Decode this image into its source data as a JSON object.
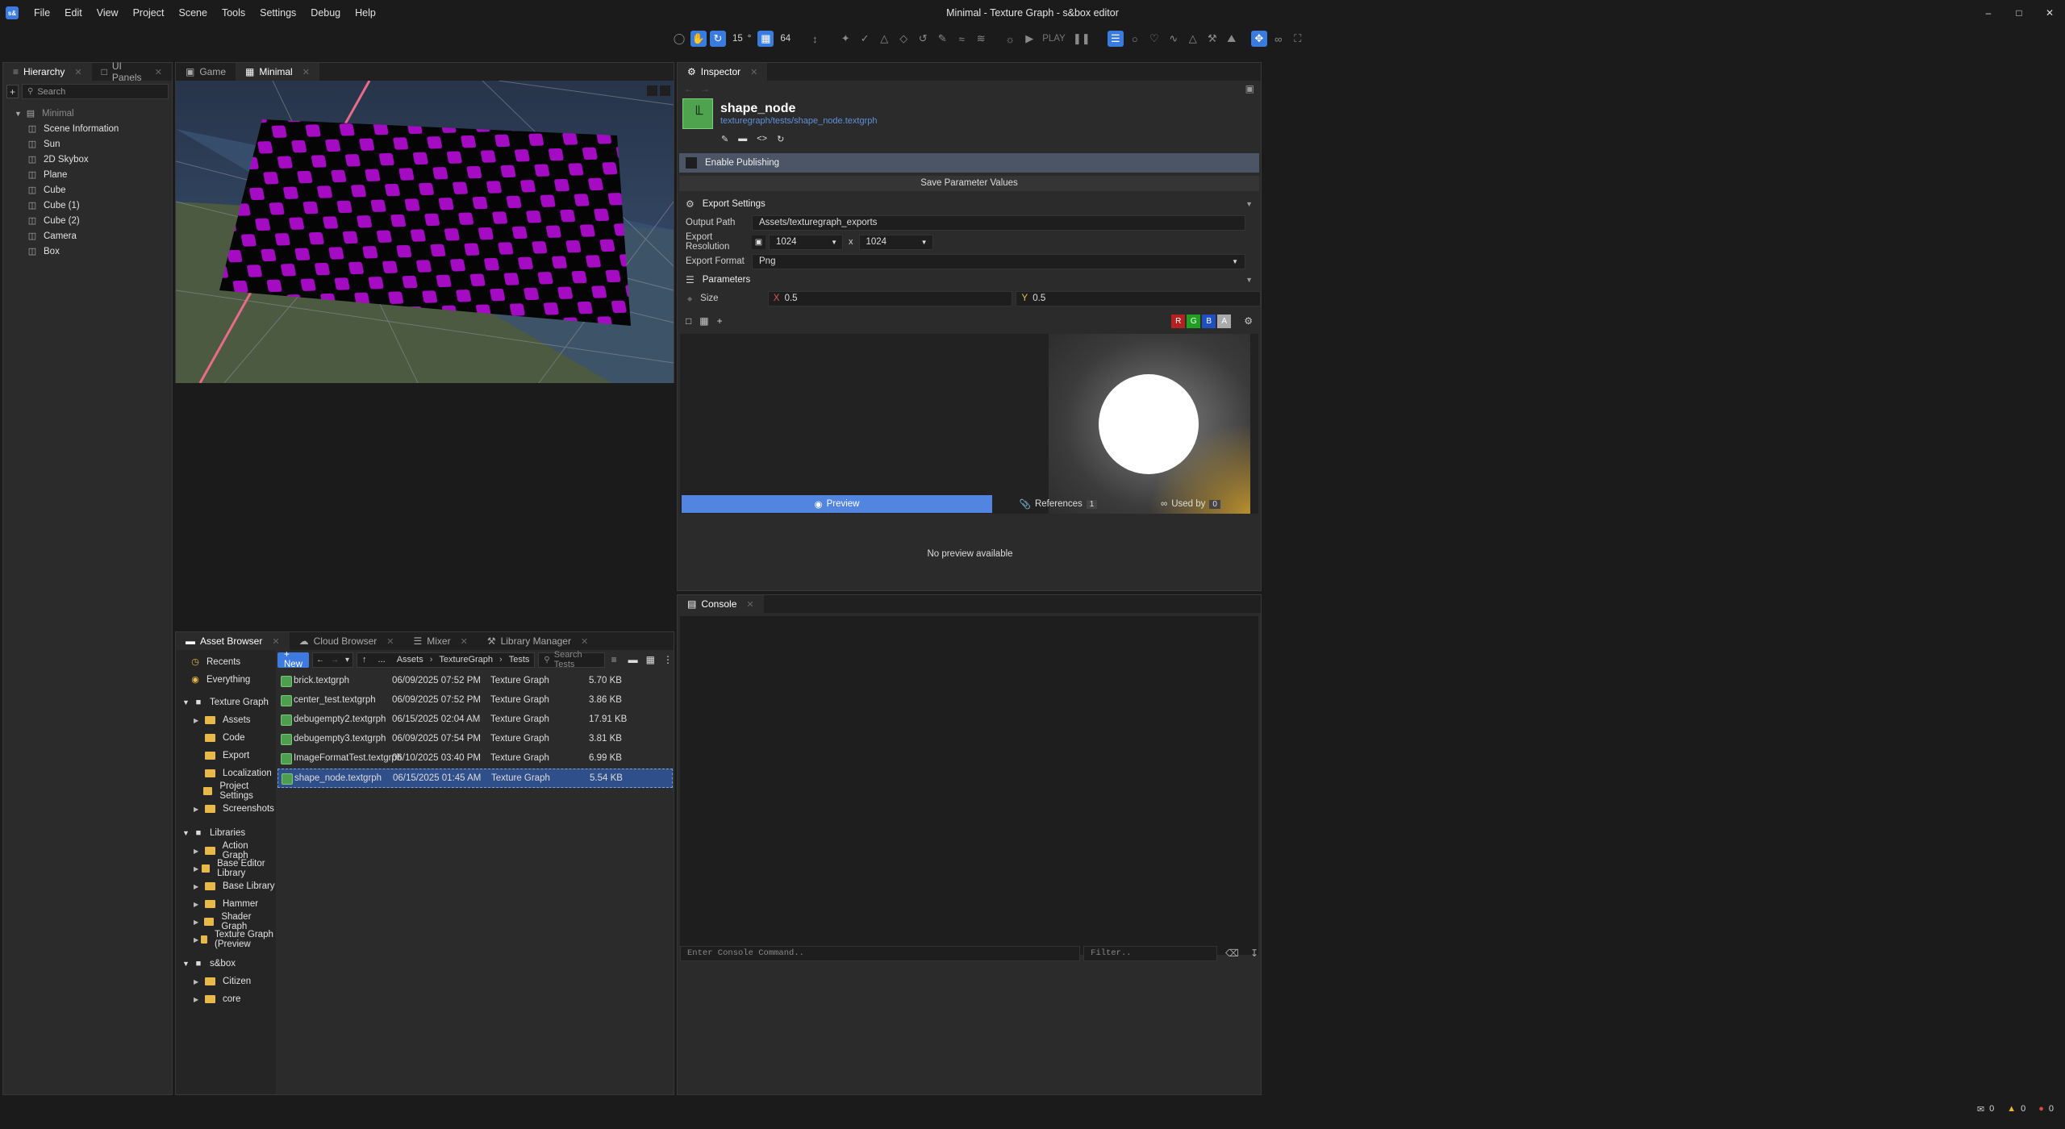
{
  "app": {
    "title": "Minimal - Texture Graph - s&box editor",
    "logo": "s&"
  },
  "menu": [
    "File",
    "Edit",
    "View",
    "Project",
    "Scene",
    "Tools",
    "Settings",
    "Debug",
    "Help"
  ],
  "toolbar": {
    "angle_snap": "15",
    "angle_unit": "°",
    "grid_size": "64",
    "play_label": "PLAY"
  },
  "hierarchy": {
    "tabs": [
      "Hierarchy",
      "UI Panels"
    ],
    "search_placeholder": "Search",
    "root": "Minimal",
    "items": [
      "Scene Information",
      "Sun",
      "2D Skybox",
      "Plane",
      "Cube",
      "Cube (1)",
      "Cube (2)",
      "Camera",
      "Box"
    ]
  },
  "viewport": {
    "tabs": [
      "Game",
      "Minimal"
    ]
  },
  "assets": {
    "tabs": [
      "Asset Browser",
      "Cloud Browser",
      "Mixer",
      "Library Manager"
    ],
    "new_label": "+ New",
    "breadcrumb": [
      "...",
      "Assets",
      "TextureGraph",
      "Tests"
    ],
    "search_placeholder": "Search Tests",
    "quick": [
      "Recents",
      "Everything"
    ],
    "project": {
      "name": "Texture Graph",
      "folders": [
        "Assets",
        "Code",
        "Export",
        "Localization",
        "Project Settings",
        "Screenshots"
      ]
    },
    "libraries": {
      "name": "Libraries",
      "items": [
        "Action Graph",
        "Base Editor Library",
        "Base Library",
        "Hammer",
        "Shader Graph",
        "Texture Graph (Preview"
      ]
    },
    "sbox": {
      "name": "s&box",
      "items": [
        "Citizen",
        "core"
      ]
    },
    "files": [
      {
        "name": "brick.textgrph",
        "date": "06/09/2025 07:52 PM",
        "type": "Texture Graph",
        "size": "5.70 KB"
      },
      {
        "name": "center_test.textgrph",
        "date": "06/09/2025 07:52 PM",
        "type": "Texture Graph",
        "size": "3.86 KB"
      },
      {
        "name": "debugempty2.textgrph",
        "date": "06/15/2025 02:04 AM",
        "type": "Texture Graph",
        "size": "17.91 KB"
      },
      {
        "name": "debugempty3.textgrph",
        "date": "06/09/2025 07:54 PM",
        "type": "Texture Graph",
        "size": "3.81 KB"
      },
      {
        "name": "ImageFormatTest.textgrph",
        "date": "06/10/2025 03:40 PM",
        "type": "Texture Graph",
        "size": "6.99 KB"
      },
      {
        "name": "shape_node.textgrph",
        "date": "06/15/2025 01:45 AM",
        "type": "Texture Graph",
        "size": "5.54 KB"
      }
    ]
  },
  "inspector": {
    "tab": "Inspector",
    "title": "shape_node",
    "path": "texturegraph/tests/shape_node.textgrph",
    "enable_publishing": "Enable Publishing",
    "save_params": "Save Parameter Values",
    "export_settings": "Export Settings",
    "output_path_label": "Output Path",
    "output_path": "Assets/texturegraph_exports",
    "export_res_label": "Export Resolution",
    "res_w": "1024",
    "res_x": "x",
    "res_h": "1024",
    "export_format_label": "Export Format",
    "export_format": "Png",
    "parameters": "Parameters",
    "size_label": "Size",
    "x_label": "X",
    "x_val": "0.5",
    "y_label": "Y",
    "y_val": "0.5",
    "channels": [
      "R",
      "G",
      "B",
      "A"
    ],
    "preview_tab": "Preview",
    "references_tab": "References",
    "references_count": "1",
    "usedby_tab": "Used by",
    "usedby_count": "0",
    "no_preview": "No preview available"
  },
  "console": {
    "tab": "Console",
    "input_placeholder": "Enter Console Command..",
    "filter_placeholder": "Filter.."
  },
  "status": {
    "messages": "0",
    "warnings": "0",
    "errors": "0"
  },
  "colors": {
    "accent": "#3d7be0",
    "checker": "#a40bc2",
    "selection": "#2f4f8a"
  }
}
